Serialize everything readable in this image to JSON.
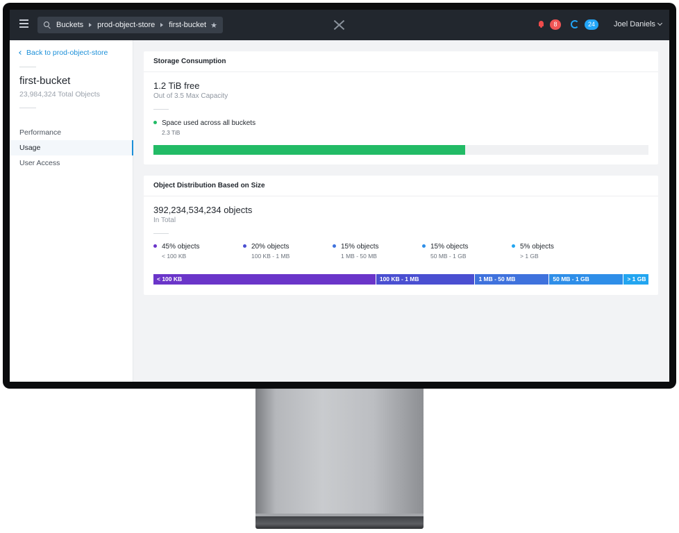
{
  "header": {
    "breadcrumbs": [
      "Buckets",
      "prod-object-store",
      "first-bucket"
    ],
    "alerts_count": "8",
    "tasks_count": "24",
    "user_name": "Joel Daniels"
  },
  "sidebar": {
    "back_label": "Back to prod-object-store",
    "bucket_name": "first-bucket",
    "bucket_objects": "23,984,324 Total Objects",
    "nav": [
      {
        "label": "Performance",
        "active": false
      },
      {
        "label": "Usage",
        "active": true
      },
      {
        "label": "User Access",
        "active": false
      }
    ]
  },
  "storage": {
    "title": "Storage Consumption",
    "free": "1.2 TiB free",
    "capacity": "Out of 3.5 Max Capacity",
    "legend_label": "Space used across all buckets",
    "legend_value": "2.3 TiB",
    "used_fraction": 0.63,
    "used_color": "#22bb66"
  },
  "distribution": {
    "title": "Object Distribution Based on Size",
    "total": "392,234,534,234 objects",
    "total_sub": "In Total",
    "buckets": [
      {
        "percent_label": "45% objects",
        "range": "< 100 KB",
        "bar_label": "< 100 KB",
        "share": 45,
        "color": "#6a35c9"
      },
      {
        "percent_label": "20% objects",
        "range": "100 KB - 1 MB",
        "bar_label": "100 KB - 1 MB",
        "share": 20,
        "color": "#4a4fd1"
      },
      {
        "percent_label": "15% objects",
        "range": "1 MB - 50 MB",
        "bar_label": "1 MB - 50 MB",
        "share": 15,
        "color": "#3f72dd"
      },
      {
        "percent_label": "15% objects",
        "range": "50 MB - 1 GB",
        "bar_label": "50 MB - 1 GB",
        "share": 15,
        "color": "#2e8ee8"
      },
      {
        "percent_label": "5% objects",
        "range": "> 1 GB",
        "bar_label": "> 1 GB",
        "share": 5,
        "color": "#22a5f0"
      }
    ]
  }
}
